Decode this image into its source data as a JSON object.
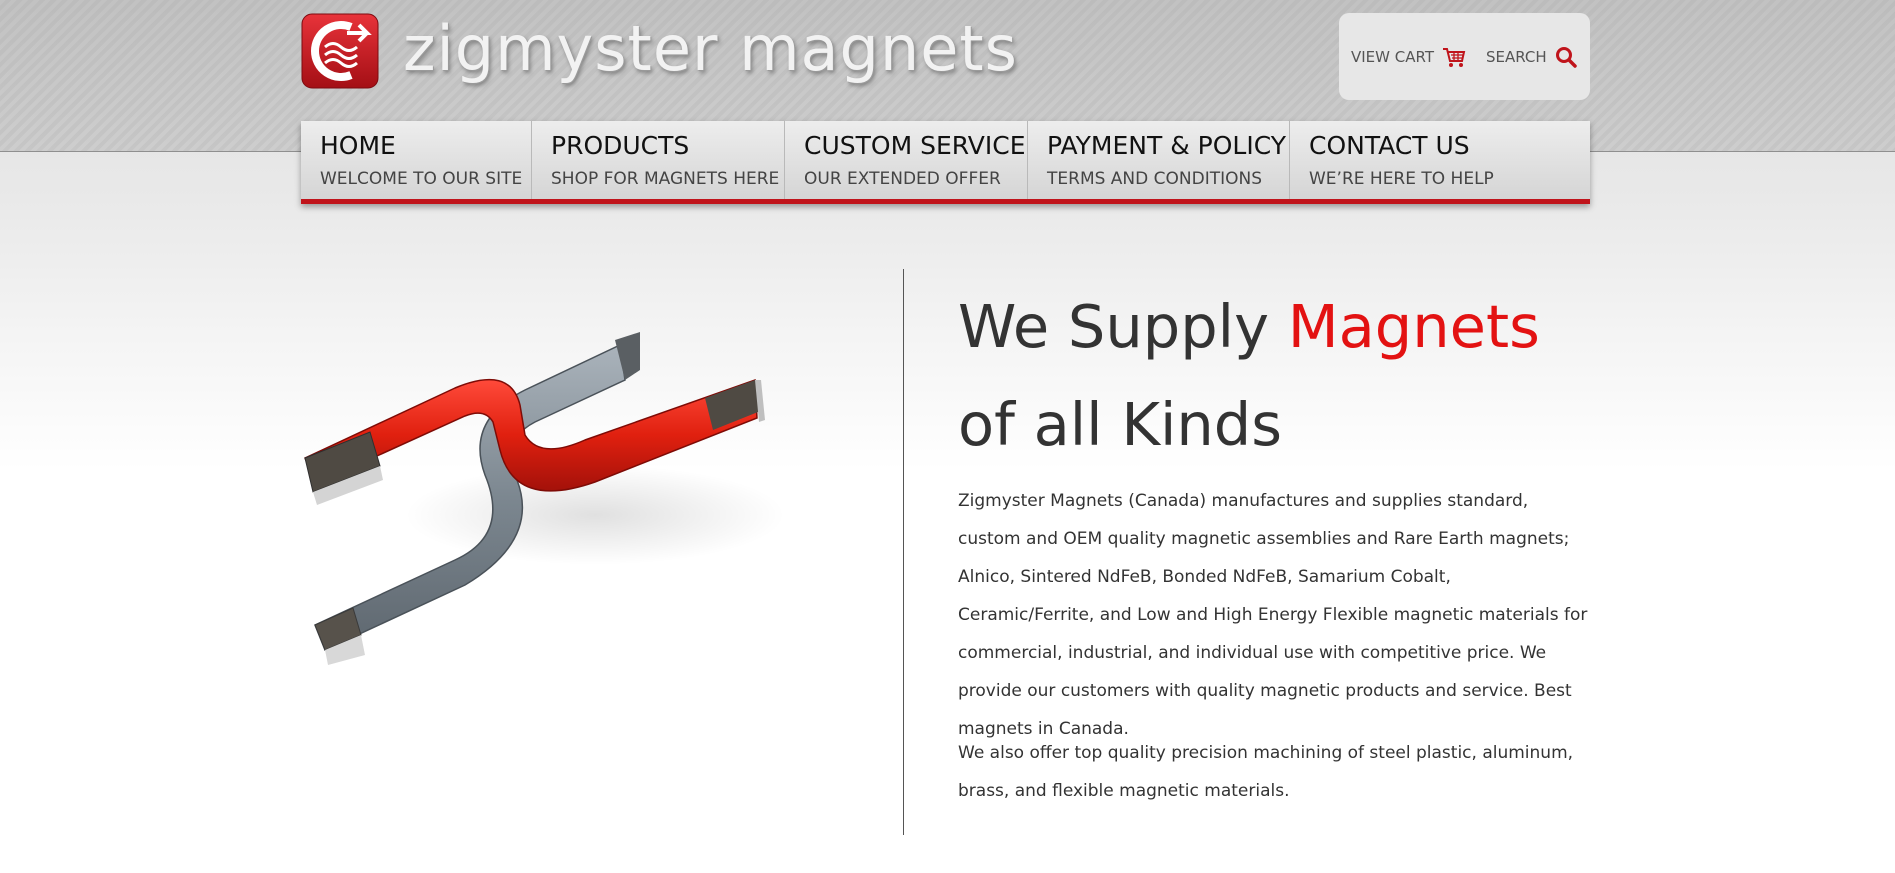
{
  "site": {
    "name": "zigmyster magnets",
    "brand_color": "#c0141b",
    "accent_color": "#e31212"
  },
  "utility": {
    "cart_label": "VIEW CART",
    "cart_icon": "cart-icon",
    "search_label": "SEARCH",
    "search_icon": "search-icon"
  },
  "nav": {
    "items": [
      {
        "title": "HOME",
        "subtitle": "WELCOME TO OUR SITE"
      },
      {
        "title": "PRODUCTS",
        "subtitle": "SHOP FOR MAGNETS HERE"
      },
      {
        "title": "CUSTOM SERVICE",
        "subtitle": "OUR EXTENDED OFFER"
      },
      {
        "title": "PAYMENT & POLICY",
        "subtitle": "TERMS AND CONDITIONS"
      },
      {
        "title": "CONTACT US",
        "subtitle": "WE’RE HERE TO HELP"
      }
    ]
  },
  "hero": {
    "image": "interlocked-horseshoe-magnets",
    "headline_part1": "We Supply ",
    "headline_accent": "Magnets",
    "headline_part2": " of all Kinds",
    "paragraph1": "Zigmyster Magnets (Canada) manufactures and supplies standard, custom and OEM quality magnetic assemblies and Rare Earth magnets; Alnico, Sintered NdFeB, Bonded NdFeB, Samarium Cobalt, Ceramic/Ferrite, and Low and High Energy Flexible magnetic materials for commercial, industrial, and individual use with competitive price.  We provide our customers with quality magnetic products and service. Best magnets in Canada.",
    "paragraph2": "We also offer top quality precision machining of steel plastic, aluminum, brass, and flexible magnetic materials."
  }
}
